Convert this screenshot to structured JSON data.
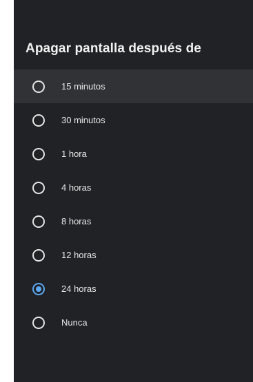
{
  "dialog": {
    "title": "Apagar pantalla después de"
  },
  "options": [
    {
      "label": "15 minutos",
      "selected": false,
      "focused": true
    },
    {
      "label": "30 minutos",
      "selected": false,
      "focused": false
    },
    {
      "label": "1 hora",
      "selected": false,
      "focused": false
    },
    {
      "label": "4 horas",
      "selected": false,
      "focused": false
    },
    {
      "label": "8 horas",
      "selected": false,
      "focused": false
    },
    {
      "label": "12 horas",
      "selected": false,
      "focused": false
    },
    {
      "label": "24 horas",
      "selected": true,
      "focused": false
    },
    {
      "label": "Nunca",
      "selected": false,
      "focused": false
    }
  ],
  "colors": {
    "panel_background": "#212226",
    "focus_highlight": "#313236",
    "accent": "#5ba8f5",
    "text": "#e8e8e8"
  },
  "icons": {
    "unselected": "radio-unchecked-icon",
    "selected": "radio-checked-icon"
  }
}
